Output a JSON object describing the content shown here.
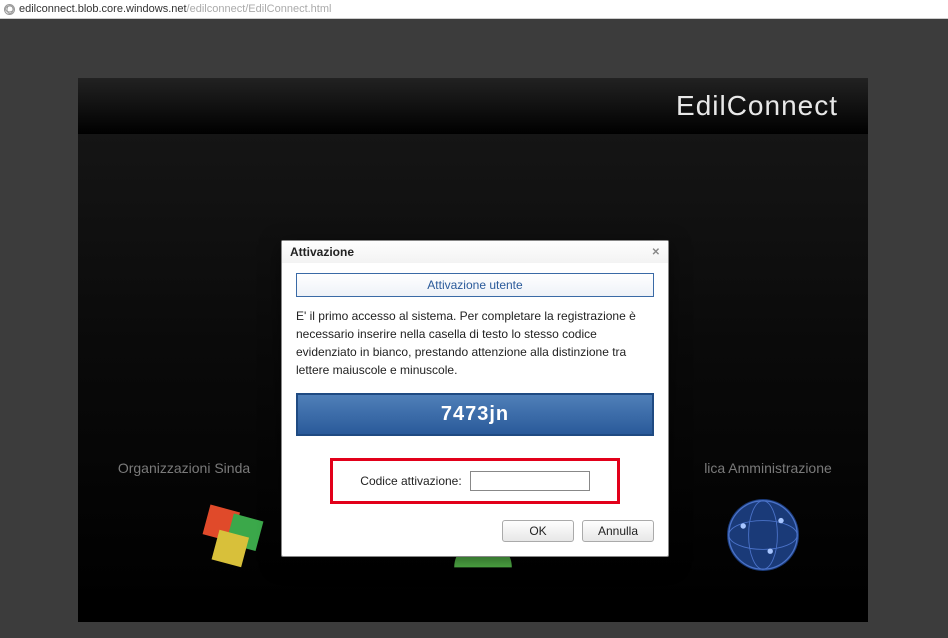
{
  "address": {
    "host": "edilconnect.blob.core.windows.net",
    "path": "/edilconnect/EdilConnect.html"
  },
  "brand": "EdilConnect",
  "background": {
    "left_label": "Organizzazioni Sinda",
    "right_label": "lica Amministrazione"
  },
  "footer": "",
  "dialog": {
    "title": "Attivazione",
    "section_title": "Attivazione utente",
    "message": "E' il primo accesso al sistema. Per completare la registrazione è necessario inserire nella casella di testo lo stesso codice evidenziato in bianco, prestando attenzione alla distinzione tra lettere maiuscole e minuscole.",
    "code": "7473jn",
    "field_label": "Codice attivazione:",
    "input_value": "",
    "ok": "OK",
    "cancel": "Annulla"
  }
}
